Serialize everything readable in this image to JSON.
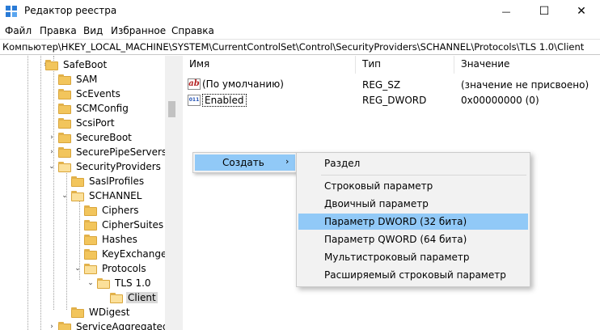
{
  "window": {
    "title": "Редактор реестра",
    "minimize_glyph": "—",
    "maximize_glyph": "☐",
    "close_glyph": "✕"
  },
  "menu": {
    "items": [
      "Файл",
      "Правка",
      "Вид",
      "Избранное",
      "Справка"
    ]
  },
  "address": {
    "path": "Компьютер\\HKEY_LOCAL_MACHINE\\SYSTEM\\CurrentControlSet\\Control\\SecurityProviders\\SCHANNEL\\Protocols\\TLS 1.0\\Client"
  },
  "tree": {
    "items": [
      {
        "label": "SafeBoot",
        "expander": "›"
      },
      {
        "label": "SAM",
        "expander": ""
      },
      {
        "label": "ScEvents",
        "expander": ""
      },
      {
        "label": "SCMConfig",
        "expander": ""
      },
      {
        "label": "ScsiPort",
        "expander": ""
      },
      {
        "label": "SecureBoot",
        "expander": "›"
      },
      {
        "label": "SecurePipeServers",
        "expander": "›"
      },
      {
        "label": "SecurityProviders",
        "expander": "⌄"
      },
      {
        "label": "SaslProfiles",
        "expander": ""
      },
      {
        "label": "SCHANNEL",
        "expander": "⌄"
      },
      {
        "label": "Ciphers",
        "expander": ""
      },
      {
        "label": "CipherSuites",
        "expander": ""
      },
      {
        "label": "Hashes",
        "expander": ""
      },
      {
        "label": "KeyExchangeA",
        "expander": ""
      },
      {
        "label": "Protocols",
        "expander": "⌄"
      },
      {
        "label": "TLS 1.0",
        "expander": "⌄"
      },
      {
        "label": "Client",
        "expander": ""
      },
      {
        "label": "WDigest",
        "expander": ""
      },
      {
        "label": "ServiceAggregatedEv",
        "expander": "›"
      }
    ]
  },
  "list": {
    "headers": {
      "name": "Имя",
      "type": "Тип",
      "value": "Значение"
    },
    "rows": [
      {
        "icon": "string-value-icon",
        "icon_text": "ab",
        "name": "(По умолчанию)",
        "type": "REG_SZ",
        "value": "(значение не присвоено)"
      },
      {
        "icon": "binary-value-icon",
        "icon_text": "011",
        "name": "Enabled",
        "type": "REG_DWORD",
        "value": "0x00000000 (0)"
      }
    ]
  },
  "context_menu": {
    "create_label": "Создать",
    "submenu_arrow": "›",
    "submenu": {
      "key": "Раздел",
      "string": "Строковый параметр",
      "binary": "Двоичный параметр",
      "dword": "Параметр DWORD (32 бита)",
      "qword": "Параметр QWORD (64 бита)",
      "multi": "Мультистроковый параметр",
      "expand": "Расширяемый строковый параметр"
    }
  },
  "colors": {
    "highlight": "#91c9f7",
    "menu_bg": "#f2f2f2",
    "folder": "#f2c55c"
  }
}
